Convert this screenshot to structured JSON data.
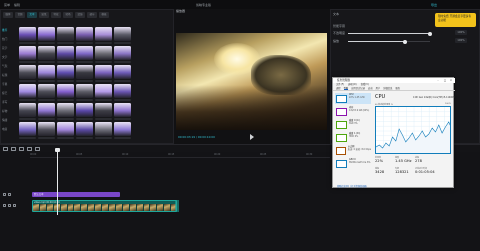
{
  "app": {
    "title": "剪映专业版",
    "menu": [
      "菜单",
      "编辑"
    ],
    "export_label": "导出"
  },
  "media": {
    "tabs": [
      "媒体",
      "音频",
      "文本",
      "贴纸",
      "特效",
      "转场",
      "滤镜",
      "调节",
      "模板"
    ],
    "selected_tab": 2,
    "sidebar": [
      "推荐",
      "热门",
      "花字",
      "文字",
      "气泡",
      "标题",
      "字幕",
      "综艺",
      "手写",
      "好物",
      "情绪",
      "电商"
    ],
    "selected_side": 0,
    "thumb_colors": [
      "#6b4fb5",
      "#8a6bd1",
      "#3c3c44",
      "#7a5fb0",
      "#a88ed8",
      "#5a5a66",
      "#9a7ad0",
      "#44444c",
      "#5e4aa6",
      "#7d66c6",
      "#6a6a72",
      "#8a74c4",
      "#4b4b55",
      "#9c86da",
      "#5f4db0",
      "#383840",
      "#7b62be",
      "#6e5bb8",
      "#a08ae0",
      "#4d4d57",
      "#845fce",
      "#5c5c66",
      "#b49ae8",
      "#6a55b2",
      "#454550",
      "#9177d2",
      "#6c6c76",
      "#5a47a8",
      "#3d3d46",
      "#8d72cc",
      "#7564c0",
      "#504f5a",
      "#a387dc",
      "#5b4aa4",
      "#6f6f7a",
      "#8e7ad4"
    ]
  },
  "player": {
    "title": "播放器",
    "timecode": "00:00:03:19 / 00:00:10:00"
  },
  "properties": {
    "title": "文本",
    "rows": [
      {
        "label": "智能字幕",
        "value": ""
      },
      {
        "label": "不透明度",
        "value": "100%",
        "fill": 1.0
      },
      {
        "label": "缩放",
        "value": "100%",
        "fill": 0.7
      }
    ],
    "promo": "限时免费 开通会员享更多专业功能"
  },
  "timeline": {
    "ticks": [
      "00:00",
      "00:05",
      "00:10",
      "00:15",
      "00:20",
      "00:25",
      "00:30"
    ],
    "text_clip": "默认文本",
    "video_clip": "video.mp4  00:00:10:00"
  },
  "task_manager": {
    "title": "任务管理器",
    "menu": [
      "文件(F)",
      "选项(O)",
      "查看(V)"
    ],
    "tabs": [
      "进程",
      "性能",
      "应用历史记录",
      "启动",
      "用户",
      "详细信息",
      "服务"
    ],
    "selected_tab": 1,
    "resources": [
      {
        "name": "CPU",
        "detail": "22% 1.45 GHz",
        "kind": "cpu"
      },
      {
        "name": "内存",
        "detail": "9.6/15.9 GB (60%)",
        "kind": "mem"
      },
      {
        "name": "磁盘 0 (C:)",
        "detail": "SSD 3%",
        "kind": "disk"
      },
      {
        "name": "磁盘 1 (D:)",
        "detail": "HDD 0%",
        "kind": "disk"
      },
      {
        "name": "以太网",
        "detail": "发送: 0 接收: 8.0 Kbps",
        "kind": "net"
      },
      {
        "name": "GPU 0",
        "detail": "NVIDIA GeForce 6%",
        "kind": "cpu"
      }
    ],
    "cpu_title": "CPU",
    "cpu_name": "11th Gen Intel(R) Core(TM) i5-11400H",
    "util_label": "60 秒内的利用率 %",
    "pct": "100%",
    "stats": [
      {
        "label": "利用率",
        "value": "22%"
      },
      {
        "label": "速度",
        "value": "1.45 GHz"
      },
      {
        "label": "进程",
        "value": "278"
      },
      {
        "label": "线程",
        "value": "3428"
      },
      {
        "label": "句柄",
        "value": "128321"
      },
      {
        "label": "正常运行时间",
        "value": "0:01:05:04"
      }
    ],
    "bottom_link": "简略信息(D) | 打开资源监视器"
  }
}
